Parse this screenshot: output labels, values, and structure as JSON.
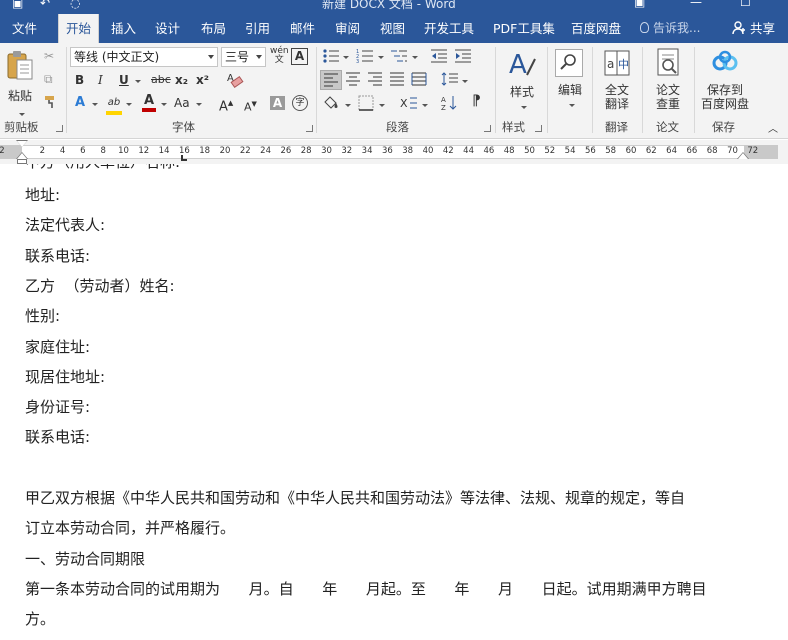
{
  "window": {
    "title": "新建 DOCX 文档 - Word"
  },
  "ribbon_tabs": [
    "文件",
    "开始",
    "插入",
    "设计",
    "布局",
    "引用",
    "邮件",
    "审阅",
    "视图",
    "开发工具",
    "PDF工具集",
    "百度网盘"
  ],
  "tell_me": "告诉我...",
  "share": "共享",
  "groups": {
    "clipboard": {
      "label": "剪贴板",
      "paste": "粘贴"
    },
    "font": {
      "label": "字体",
      "font_name": "等线 (中文正文)",
      "font_size": "三号",
      "wen": "wén",
      "bold": "B",
      "italic": "I",
      "underline": "U",
      "strike": "abc",
      "subscript": "x₂",
      "superscript": "x²",
      "text_effect": "A",
      "highlight": "ab",
      "font_color": "A",
      "change_case": "Aa",
      "grow": "A",
      "shrink": "A",
      "char_shade": "A",
      "enclose": "字",
      "char_border": "A"
    },
    "paragraph": {
      "label": "段落"
    },
    "styles": {
      "label": "样式",
      "button": "样式"
    },
    "editing": {
      "button": "编辑"
    },
    "translate": {
      "label": "翻译",
      "button_line1": "全文",
      "button_line2": "翻译"
    },
    "paper": {
      "label": "论文",
      "button_line1": "论文",
      "button_line2": "查重"
    },
    "save": {
      "label": "保存",
      "button_line1": "保存到",
      "button_line2": "百度网盘"
    }
  },
  "ruler": {
    "ticks": [
      "2",
      "2",
      "4",
      "6",
      "8",
      "10",
      "12",
      "14",
      "16",
      "18",
      "20",
      "22",
      "24",
      "26",
      "28",
      "30",
      "32",
      "34",
      "36",
      "38",
      "40",
      "42",
      "44",
      "46",
      "48",
      "50",
      "52",
      "54",
      "56",
      "58",
      "60",
      "62",
      "64",
      "66",
      "68",
      "70",
      "72"
    ]
  },
  "document": {
    "lines": [
      "地址:",
      "法定代表人:",
      "联系电话:",
      "乙方  （劳动者）姓名:",
      "性别:",
      "家庭住址:",
      "现居住地址:",
      "身份证号:",
      "联系电话:",
      "",
      "甲乙双方根据《中华人民共和国劳动和《中华人民共和国劳动法》等法律、法规、规章的规定，等自",
      "订立本劳动合同，并严格履行。",
      "一、劳动合同期限",
      "第一条本劳动合同的试用期为      月。自      年      月起。至      年      月      日起。试用期满甲方聘目",
      "方。"
    ]
  },
  "colors": {
    "ribbon_blue": "#2b579a",
    "ribbon_bg": "#f3f3f3"
  }
}
